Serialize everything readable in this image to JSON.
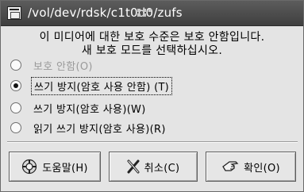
{
  "window": {
    "title": "/vol/dev/rdsk/c1t0d0/zufs"
  },
  "message": {
    "line1": "이 미디어에 대한 보호 수준은 보호 안함입니다.",
    "line2": "새 보호 모드를 선택하십시오."
  },
  "options": [
    {
      "label": "보호 안함(O)",
      "selected": false,
      "disabled": true
    },
    {
      "label": "쓰기 방지(암호 사용 안함) (T)",
      "selected": true,
      "disabled": false
    },
    {
      "label": "쓰기 방지(암호 사용)(W)",
      "selected": false,
      "disabled": false
    },
    {
      "label": "읽기 쓰기 방지(암호 사용)(R)",
      "selected": false,
      "disabled": false
    }
  ],
  "buttons": {
    "help": {
      "label": "도움말(H)",
      "icon": "lifebuoy-icon"
    },
    "cancel": {
      "label": "취소(C)",
      "icon": "x-icon"
    },
    "ok": {
      "label": "확인(O)",
      "icon": "hand-icon"
    }
  }
}
